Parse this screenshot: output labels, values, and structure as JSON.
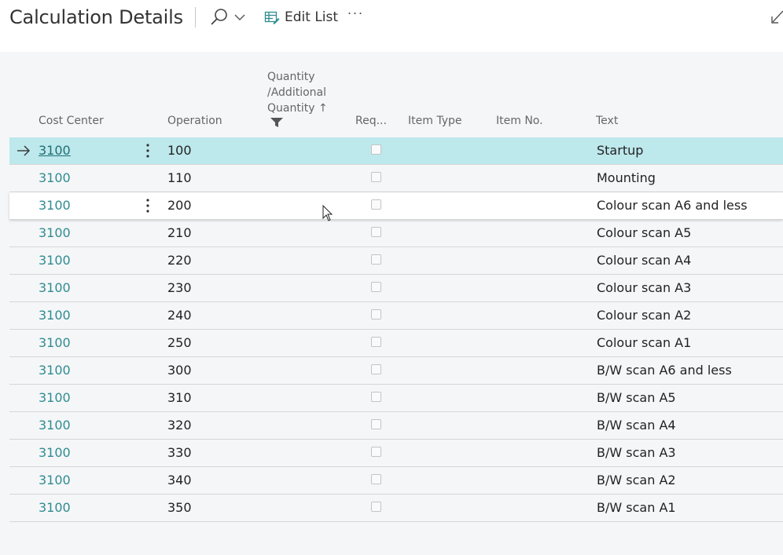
{
  "header": {
    "title": "Calculation Details",
    "edit_list_label": "Edit List",
    "more_label": "···"
  },
  "columns": {
    "cost_center": "Cost Center",
    "operation": "Operation",
    "quantity_line1": "Quantity",
    "quantity_line2": "/Additional",
    "quantity_line3": "Quantity ↑",
    "required": "Req...",
    "item_type": "Item Type",
    "item_no": "Item No.",
    "text": "Text"
  },
  "colors": {
    "accent": "#2f8c90",
    "selected_row": "#bde8ec",
    "grid_background": "#f5f6f8"
  },
  "rows": [
    {
      "cost_center": "3100",
      "operation": "100",
      "text": "Startup"
    },
    {
      "cost_center": "3100",
      "operation": "110",
      "text": "Mounting"
    },
    {
      "cost_center": "3100",
      "operation": "200",
      "text": "Colour scan A6 and less"
    },
    {
      "cost_center": "3100",
      "operation": "210",
      "text": "Colour scan A5"
    },
    {
      "cost_center": "3100",
      "operation": "220",
      "text": "Colour scan A4"
    },
    {
      "cost_center": "3100",
      "operation": "230",
      "text": "Colour scan A3"
    },
    {
      "cost_center": "3100",
      "operation": "240",
      "text": "Colour scan A2"
    },
    {
      "cost_center": "3100",
      "operation": "250",
      "text": "Colour scan A1"
    },
    {
      "cost_center": "3100",
      "operation": "300",
      "text": "B/W scan A6 and less"
    },
    {
      "cost_center": "3100",
      "operation": "310",
      "text": "B/W scan A5"
    },
    {
      "cost_center": "3100",
      "operation": "320",
      "text": "B/W scan A4"
    },
    {
      "cost_center": "3100",
      "operation": "330",
      "text": "B/W scan A3"
    },
    {
      "cost_center": "3100",
      "operation": "340",
      "text": "B/W scan A2"
    },
    {
      "cost_center": "3100",
      "operation": "350",
      "text": "B/W scan A1"
    }
  ]
}
